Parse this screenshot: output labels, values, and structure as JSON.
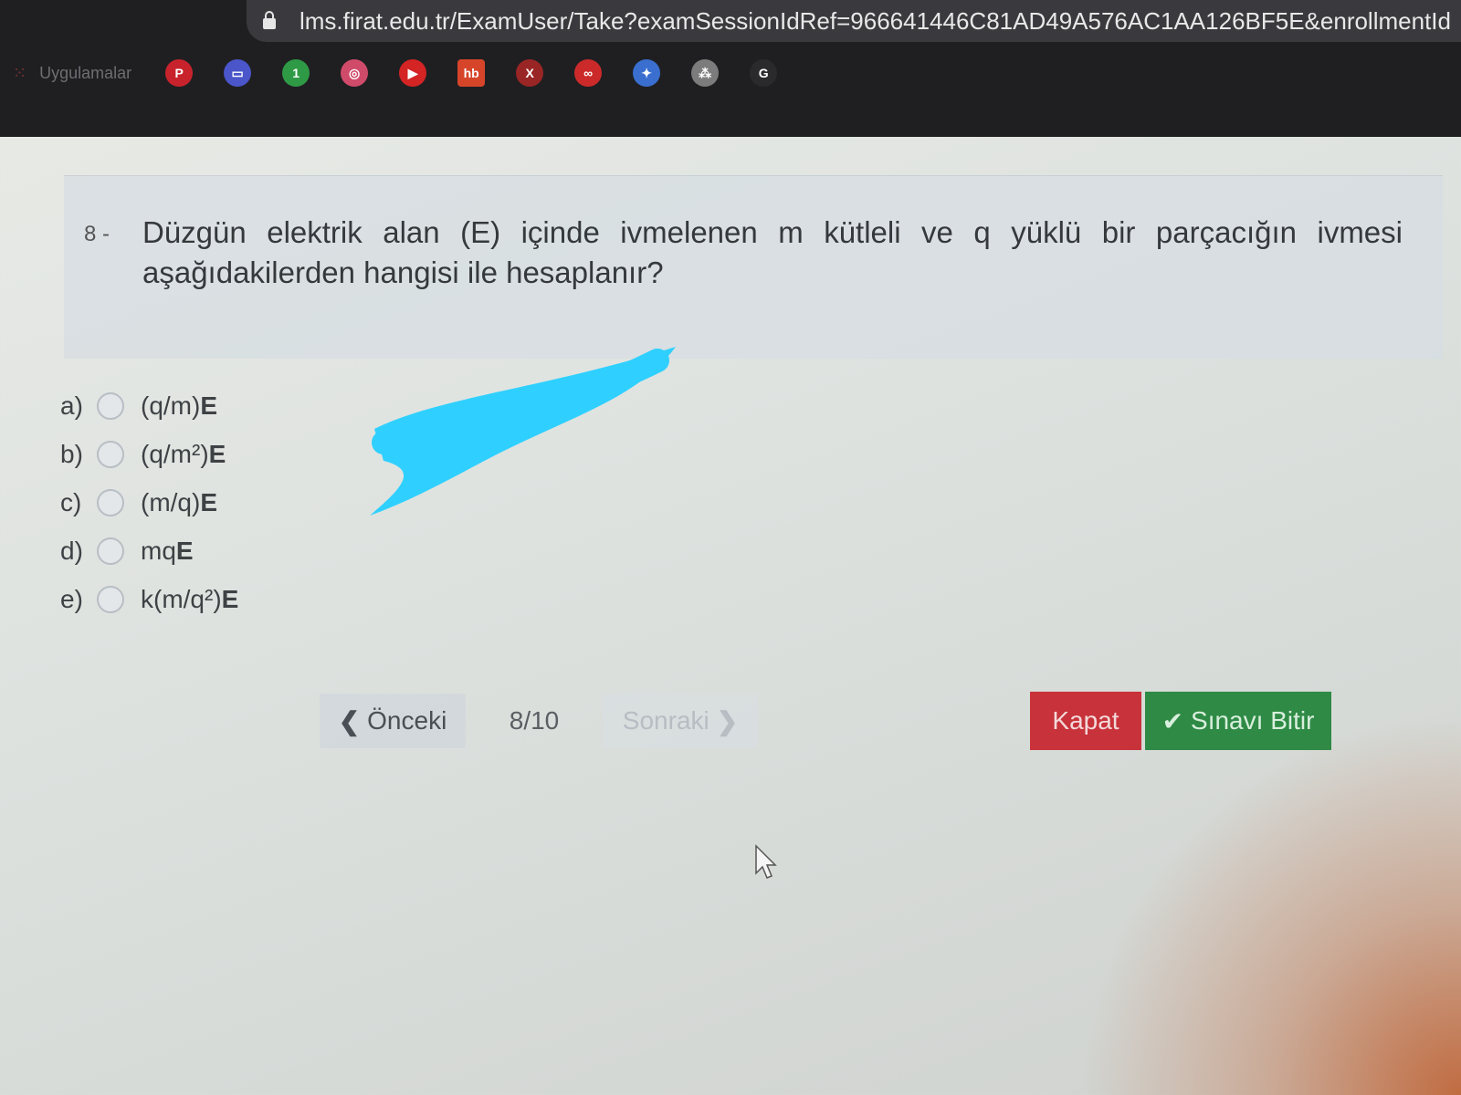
{
  "browser": {
    "url": "lms.firat.edu.tr/ExamUser/Take?examSessionIdRef=966641446C81AD49A576AC1AA126BF5E&enrollmentId",
    "apps_label": "Uygulamalar",
    "bookmarks": [
      {
        "icon": "pinterest-icon",
        "glyph": "P",
        "color": "#c8232c"
      },
      {
        "icon": "message-icon",
        "glyph": "▭",
        "color": "#4a56c9"
      },
      {
        "icon": "whatsapp-icon",
        "glyph": "1",
        "color": "#2f9a45"
      },
      {
        "icon": "instagram-icon",
        "glyph": "◎",
        "color": "#d04b6a"
      },
      {
        "icon": "youtube-icon",
        "glyph": "▶",
        "color": "#d42424"
      },
      {
        "icon": "hepsiburada-icon",
        "glyph": "hb",
        "color": "#d6452a"
      },
      {
        "icon": "x-icon",
        "glyph": "X",
        "color": "#9a2525"
      },
      {
        "icon": "cleartrip-icon",
        "glyph": "∞",
        "color": "#cc2a2a"
      },
      {
        "icon": "twitter-icon",
        "glyph": "✦",
        "color": "#3a6fd0"
      },
      {
        "icon": "bookmark-icon",
        "glyph": "⁂",
        "color": "#7c7c7c"
      },
      {
        "icon": "google-icon",
        "glyph": "G",
        "color": "#ffffff"
      }
    ]
  },
  "question": {
    "number": "8 -",
    "text": "Düzgün elektrik alan (E) içinde ivmelenen m kütleli ve q yüklü bir parçacığın ivmesi aşağıdakilerden hangisi ile hesaplanır?"
  },
  "options": [
    {
      "letter": "a)",
      "formula_pre": "(q/m)",
      "formula_bold": "E"
    },
    {
      "letter": "b)",
      "formula_pre": "(q/m²)",
      "formula_bold": "E"
    },
    {
      "letter": "c)",
      "formula_pre": "(m/q)",
      "formula_bold": "E"
    },
    {
      "letter": "d)",
      "formula_pre": "mq",
      "formula_bold": "E"
    },
    {
      "letter": "e)",
      "formula_pre": "k(m/q²)",
      "formula_bold": "E"
    }
  ],
  "navigation": {
    "prev_label": "Önceki",
    "page": "8/10",
    "next_label": "Sonraki"
  },
  "actions": {
    "close_label": "Kapat",
    "finish_label": "Sınavı Bitir"
  },
  "colors": {
    "close": "#c8323a",
    "finish": "#2f8a45",
    "scribble": "#2fd0ff"
  }
}
